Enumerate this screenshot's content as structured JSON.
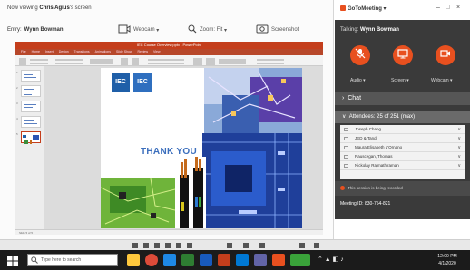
{
  "share_window": {
    "caption_prefix": "Now viewing",
    "caption_name": "Chris Agius",
    "caption_suffix": "'s screen",
    "presenter_label": "Entry:",
    "presenter_name": "Wynn Bowman",
    "webcam_label": "Webcam",
    "zoom_label": "Zoom: Fit",
    "screenshot_label": "Screenshot"
  },
  "powerpoint": {
    "title_bar": "IEC Course Overview.pptx - PowerPoint",
    "tabs": [
      "File",
      "Home",
      "Insert",
      "Design",
      "Transitions",
      "Animations",
      "Slide Show",
      "Review",
      "View"
    ],
    "status_text": "Slide 5 of 5",
    "slide": {
      "logo_left": "IEC",
      "logo_right": "IEC",
      "title": "THANK YOU"
    }
  },
  "meeting": {
    "app_name": "GoToMeeting",
    "talking_label": "Talking:",
    "talking_name": "Wynn Bowman",
    "buttons": [
      {
        "label": "Audio",
        "icon": "microphone-muted-icon",
        "color": "#e8501f"
      },
      {
        "label": "Screen",
        "icon": "screen-share-icon",
        "color": "#e8501f"
      },
      {
        "label": "Webcam",
        "icon": "webcam-icon",
        "color": "#e8501f"
      }
    ],
    "chat_label": "Chat",
    "attendees_label": "Attendees: 25 of 251 (max)",
    "attendees": [
      "Joseph Chang",
      "JED & Tandi",
      "Maura Elisabeth d'Ornano",
      "Rauscegan, Thomas",
      "Nickolay Rajmathiraman"
    ],
    "notice": "This session is being recorded",
    "meeting_id": "Meeting ID: 830-754-821"
  },
  "taskbar": {
    "search_placeholder": "Type here to search",
    "time": "12:00 PM",
    "date": "4/1/2020"
  },
  "colors": {
    "accent": "#e8501f",
    "panel_dark": "#3a3a3a",
    "ppt_brand": "#c43e1c"
  }
}
